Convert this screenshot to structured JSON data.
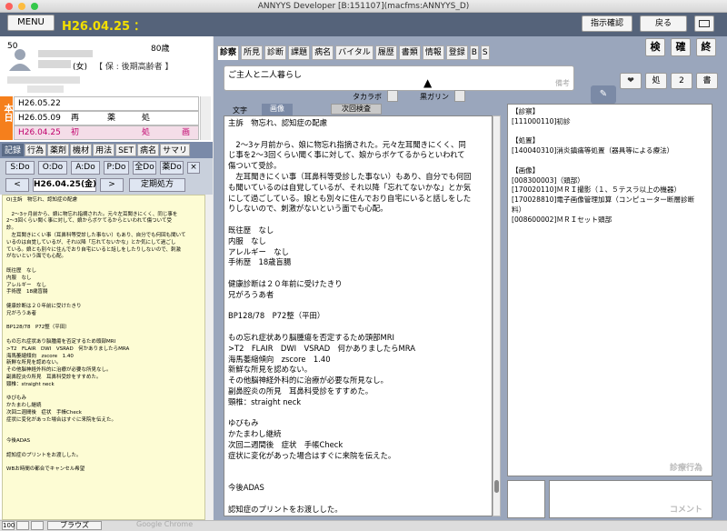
{
  "window_title": "ANNYYS Developer [B:151107](macfms:ANNYYS_D)",
  "header": {
    "menu": "MENU",
    "date": "H26.04.25",
    "colon": "：",
    "confirm": "指示確認",
    "back": "戻る"
  },
  "patient": {
    "age_num": "50",
    "age": "80歳",
    "gender": "(女)",
    "insurance": "【 保 : 後期高齢者 】"
  },
  "visits": {
    "today": "本日",
    "rows": [
      {
        "date": "H26.05.22",
        "type": "",
        "kind": "",
        "mark": ""
      },
      {
        "date": "H26.05.09",
        "type": "再",
        "kind": "薬",
        "mark": "処"
      },
      {
        "date": "H26.04.25",
        "type": "初",
        "kind": "処",
        "mark": "画"
      }
    ]
  },
  "left_tabs": [
    "記録",
    "行為",
    "薬剤",
    "機材",
    "用法",
    "SET",
    "病名",
    "サマリ"
  ],
  "soap_buttons": [
    "S:Do",
    "O:Do",
    "A:Do",
    "P:Do",
    "全Do",
    "薬Do"
  ],
  "close": "×",
  "nav": {
    "prev": "<",
    "date": "H26.04.25(金)",
    "next": ">",
    "periodic": "定期処方"
  },
  "left_note": "O)主訴　物忘れ、認知症の配慮\n\n　2〜3ヶ月前から、娘に物忘れ指摘された。元々左耳聞きにくく、同じ事を\n2〜3回くらい聞く事に対して、娘からボケてるからといわれて傷ついて受\n診。\n　左耳聞きにくい事（耳鼻科等受診した事ない）もあり、自分でも何回も聞いて\nいるのは自覚しているが、それ以降「忘れてないかな」とか気にして過ごし\nている。娘とも別々に住んでおり自宅にいると話しをしたりしないので、刺激\nがないという面でも心配。\n\n既往歴　なし\n内服　なし\nアレルギー　なし\n手術歴　18歳盲腸\n\n健康診断は２０年前に受けたきり\n兄がろうあ者\n\nBP128/78　P72整（平田）\n\nもの忘れ症状あり脳腫瘍を否定するため頭部MRI\n>T2　FLAIR　DWI　VSRAD　何かありましたらMRA\n海馬萎縮傾向　zscore　1.40\n新鮮な所見を認めない。\nその他脳神経外科的に治療が必要な所見なし。\n副鼻腔炎の所見　耳鼻科受診をすすめた。\n頸椎：straight neck\n\nゆびもみ\nかたまわし継続\n次回二週間後　症状　手帳Check\n症状に変化があった場合はすぐに来院を伝えた。\n\n\n今後ADAS\n\n認知症のプリントをお渡しした。\n\nWBお時間の都合でキャンセル希望",
  "status": {
    "zoom": "100",
    "browse": "ブラウズ",
    "chrome": "Google Chrome"
  },
  "main_tabs": [
    "診察",
    "所見",
    "診断",
    "課題",
    "病名",
    "バイタル",
    "履歴",
    "書類",
    "情報",
    "登録"
  ],
  "bs": [
    "B",
    "S"
  ],
  "right_buttons": [
    "検",
    "確",
    "終"
  ],
  "summary": {
    "text": "ご主人と二人暮らし",
    "placeholder": "備考"
  },
  "icons_row": {
    "heart": "❤",
    "sho": "処",
    "two": "2",
    "sho2": "書"
  },
  "checks": {
    "takaravo": "タカラボ",
    "kuro": "黒ガリン"
  },
  "next_exam": "次回検査",
  "subtabs": [
    "文字",
    "画像"
  ],
  "main_note": "主訴　物忘れ、認知症の配慮\n\n　2〜3ヶ月前から、娘に物忘れ指摘された。元々左耳聞きにくく、同\nじ事を2〜3回くらい聞く事に対して、娘からボケてるからといわれて\n傷ついて受診。\n　左耳聞きにくい事（耳鼻科等受診した事ない）もあり、自分でも何回\nも聞いているのは自覚しているが、それ以降「忘れてないかな」とか気\nにして過ごしている。娘とも別々に住んでおり自宅にいると話しをした\nりしないので、刺激がないという面でも心配。\n\n既往歴　なし\n内服　なし\nアレルギー　なし\n手術歴　18歳盲腸\n\n健康診断は２０年前に受けたきり\n兄がろうあ者\n\nBP128/78　P72整（平田）\n\nもの忘れ症状あり脳腫瘍を否定するため頭部MRI\n>T2　FLAIR　DWI　VSRAD　何かありましたらMRA\n海馬萎縮傾向　zscore　1.40\n新鮮な所見を認めない。\nその他脳神経外科的に治療が必要な所見なし。\n副鼻腔炎の所見　耳鼻科受診をすすめた。\n頸椎：straight neck\n\nゆびもみ\nかたまわし継続\n次回二週間後　症状　手帳Check\n症状に変化があった場合はすぐに来院を伝えた。\n\n\n今後ADAS\n\n認知症のプリントをお渡しした。\n\nWBお時間の都合でキャンセル希望",
  "orders": "【診察】\n[111000110]初診\n\n【処置】\n[140040310]消炎鎮痛等処置（器具等による療法）\n\n【画像】\n[008300003]（頭部）\n[170020110]ＭＲＩ撮影（１、５テスラ以上の機器）\n[170028810]電子画像管理加算（コンピューター断層診断\n料）\n[008600002]ＭＲＩセット頭部",
  "orders_label": "診療行為",
  "comment_label": "コメント"
}
